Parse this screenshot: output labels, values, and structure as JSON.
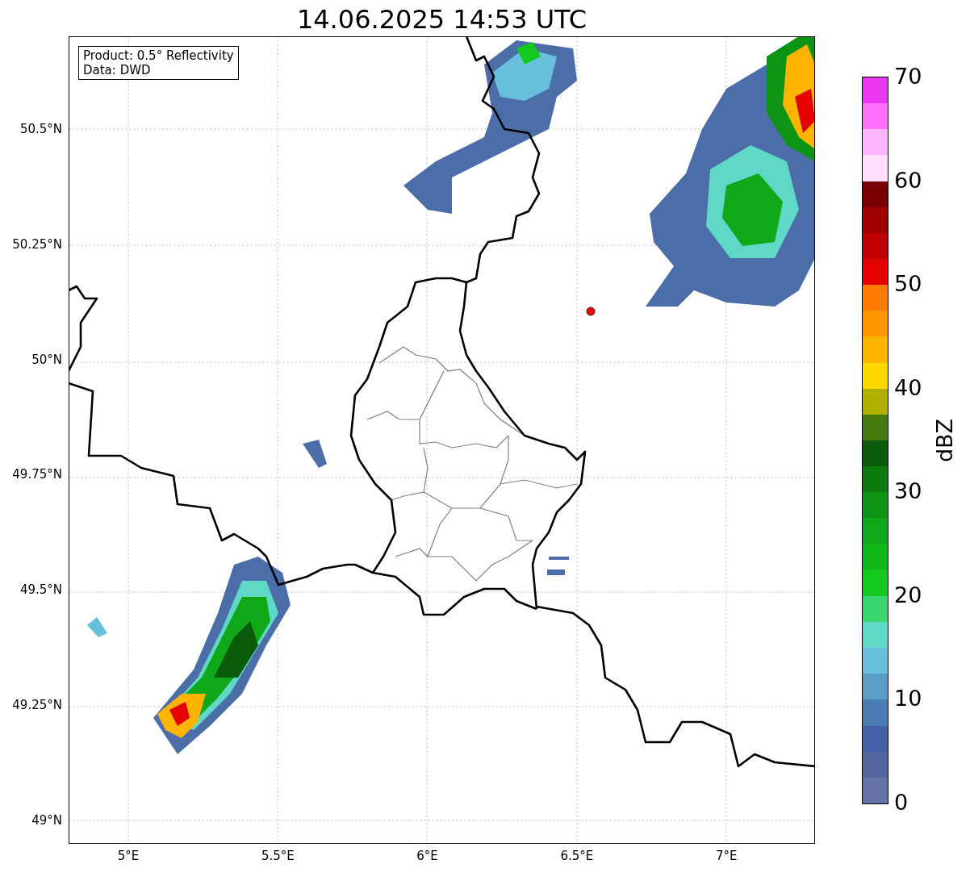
{
  "title": "14.06.2025 14:53 UTC",
  "legend": [
    "Product: 0.5° Reflectivity",
    "Data: DWD"
  ],
  "x_ticks": [
    "5°E",
    "5.5°E",
    "6°E",
    "6.5°E",
    "7°E"
  ],
  "y_ticks": [
    "50.5°N",
    "50.25°N",
    "50°N",
    "49.75°N",
    "49.5°N",
    "49.25°N",
    "49°N"
  ],
  "colorbar": {
    "label": "dBZ",
    "ticks": [
      "70",
      "60",
      "50",
      "40",
      "30",
      "20",
      "10",
      "0"
    ],
    "segments": [
      {
        "color": "#e838f0"
      },
      {
        "color": "#ff70ff"
      },
      {
        "color": "#ffb4ff"
      },
      {
        "color": "#ffe0ff"
      },
      {
        "color": "#780000"
      },
      {
        "color": "#a00000"
      },
      {
        "color": "#c00000"
      },
      {
        "color": "#e40000"
      },
      {
        "color": "#ff7c00"
      },
      {
        "color": "#ff9800"
      },
      {
        "color": "#ffb400"
      },
      {
        "color": "#ffd800"
      },
      {
        "color": "#b0b000"
      },
      {
        "color": "#447a0c"
      },
      {
        "color": "#0a5c0c"
      },
      {
        "color": "#0c7c10"
      },
      {
        "color": "#0e9414"
      },
      {
        "color": "#10a818"
      },
      {
        "color": "#12b81a"
      },
      {
        "color": "#14c81e"
      },
      {
        "color": "#3cd670"
      },
      {
        "color": "#60d8c8"
      },
      {
        "color": "#66c0dc"
      },
      {
        "color": "#5a9ec8"
      },
      {
        "color": "#4a7cb4"
      },
      {
        "color": "#4460a8"
      },
      {
        "color": "#5366a0"
      },
      {
        "color": "#6474a8"
      }
    ]
  }
}
